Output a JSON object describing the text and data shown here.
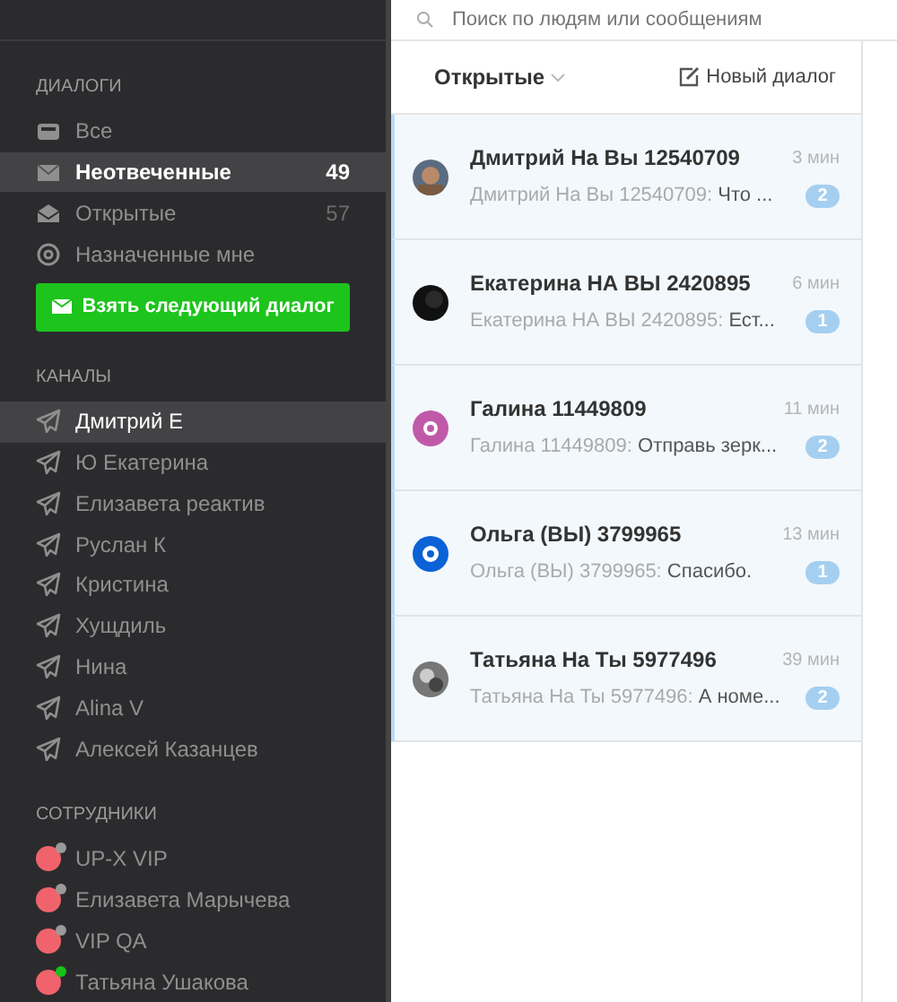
{
  "search": {
    "placeholder": "Поиск по людям или сообщениям"
  },
  "sidebar": {
    "dialogs_title": "ДИАЛОГИ",
    "dialogs": [
      {
        "kind": "inbox",
        "label": "Все",
        "selected": false
      },
      {
        "kind": "mail",
        "label": "Неотвеченные",
        "count": "49",
        "selected": true
      },
      {
        "kind": "open",
        "label": "Открытые",
        "count": "57",
        "selected": false
      },
      {
        "kind": "at",
        "label": "Назначенные мне",
        "selected": false
      }
    ],
    "next_button": "Взять следующий диалог",
    "channels_title": "КАНАЛЫ",
    "channels": [
      {
        "label": "Дмитрий Е",
        "selected": true
      },
      {
        "label": "Ю Екатерина",
        "selected": false
      },
      {
        "label": "Елизавета реактив",
        "selected": false
      },
      {
        "label": "Руслан К",
        "selected": false
      },
      {
        "label": "Кристина",
        "selected": false
      },
      {
        "label": "Хущдиль",
        "selected": false
      },
      {
        "label": "Нина",
        "selected": false
      },
      {
        "label": "Alina V",
        "selected": false
      },
      {
        "label": "Алексей Казанцев",
        "selected": false
      }
    ],
    "staff_title": "СОТРУДНИКИ",
    "staff": [
      {
        "label": "UP-X VIP",
        "online": false
      },
      {
        "label": "Елизавета Марычева",
        "online": false
      },
      {
        "label": "VIP QA",
        "online": false
      },
      {
        "label": "Татьяна Ушакова",
        "online": true
      }
    ]
  },
  "list": {
    "filter": "Открытые",
    "new_dialog": "Новый диалог",
    "dialogs": [
      {
        "name": "Дмитрий На Вы 12540709",
        "time": "3 мин",
        "author": "Дмитрий На Вы 12540709:",
        "message": "Что ...",
        "unread": "2"
      },
      {
        "name": "Екатерина НА ВЫ 2420895",
        "time": "6 мин",
        "author": "Екатерина НА ВЫ 2420895:",
        "message": "Ест...",
        "unread": "1"
      },
      {
        "name": "Галина 11449809",
        "time": "11 мин",
        "author": "Галина 11449809:",
        "message": "Отправь зерк...",
        "unread": "2"
      },
      {
        "name": "Ольга (ВЫ) 3799965",
        "time": "13 мин",
        "author": "Ольга (ВЫ) 3799965:",
        "message": "Спасибо.",
        "unread": "1"
      },
      {
        "name": "Татьяна На Ты 5977496",
        "time": "39 мин",
        "author": "Татьяна На Ты 5977496:",
        "message": "А номе...",
        "unread": "2"
      }
    ]
  }
}
